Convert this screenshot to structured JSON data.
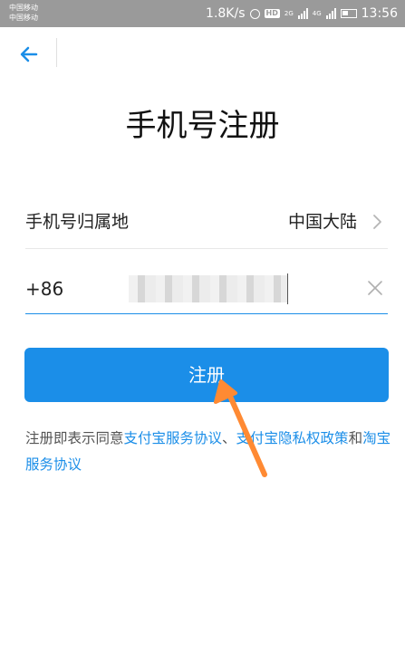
{
  "status_bar": {
    "carrier_1": "中国移动",
    "carrier_2": "中国移动",
    "net_speed": "1.8K/s",
    "network_1": "2G",
    "network_2": "4G",
    "time": "13:56"
  },
  "page": {
    "title": "手机号注册"
  },
  "region": {
    "label": "手机号归属地",
    "value": "中国大陆"
  },
  "phone": {
    "country_code": "+86",
    "value_blurred": true
  },
  "register_button": {
    "label": "注册"
  },
  "agreement": {
    "prefix": "注册即表示同意",
    "link_1": "支付宝服务协议",
    "sep": "、",
    "link_2": "支付宝隐私权政策",
    "and": "和",
    "link_3": "淘宝服务协议"
  },
  "colors": {
    "accent": "#1b8ee8",
    "status_bar": "#9a9a9a",
    "annotation_arrow": "#ff8a33"
  }
}
